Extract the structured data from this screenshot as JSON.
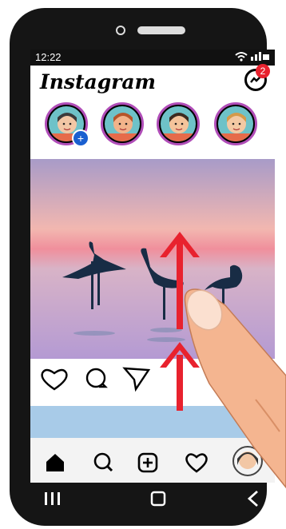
{
  "status": {
    "time": "12:22",
    "icons": "wifi signal battery"
  },
  "header": {
    "logo": "Instagram",
    "messenger_badge": "2"
  },
  "stories": [
    {
      "name": "your-story",
      "hair": "#3b3b3b",
      "skin": "#f2c7a5",
      "ring": "#444444",
      "add": "+"
    },
    {
      "name": "friend-1",
      "hair": "#b5552a",
      "skin": "#f2b38a",
      "ring": "#c44b9a"
    },
    {
      "name": "friend-2",
      "hair": "#3d2b1f",
      "skin": "#f4c49b",
      "ring": "#c44b9a"
    },
    {
      "name": "friend-3",
      "hair": "#d49a4a",
      "skin": "#f4c9a3",
      "ring": "#c44b9a"
    }
  ],
  "post": {
    "sky_top": "#b7a5c9",
    "sky_mid": "#f3a8a8",
    "water": "#b79ed0",
    "bird_color": "#182c45"
  },
  "gesture": {
    "arrow_color": "#e8222e",
    "direction": "swipe-up"
  },
  "icons": {
    "like": "heart-icon",
    "comment": "comment-icon",
    "share": "send-icon",
    "home": "home-icon",
    "search": "search-icon",
    "add": "add-post-icon",
    "activity": "heart-icon",
    "profile": "avatar"
  },
  "sysnav": {
    "recent": "|||",
    "home": "▢",
    "back": "<"
  }
}
